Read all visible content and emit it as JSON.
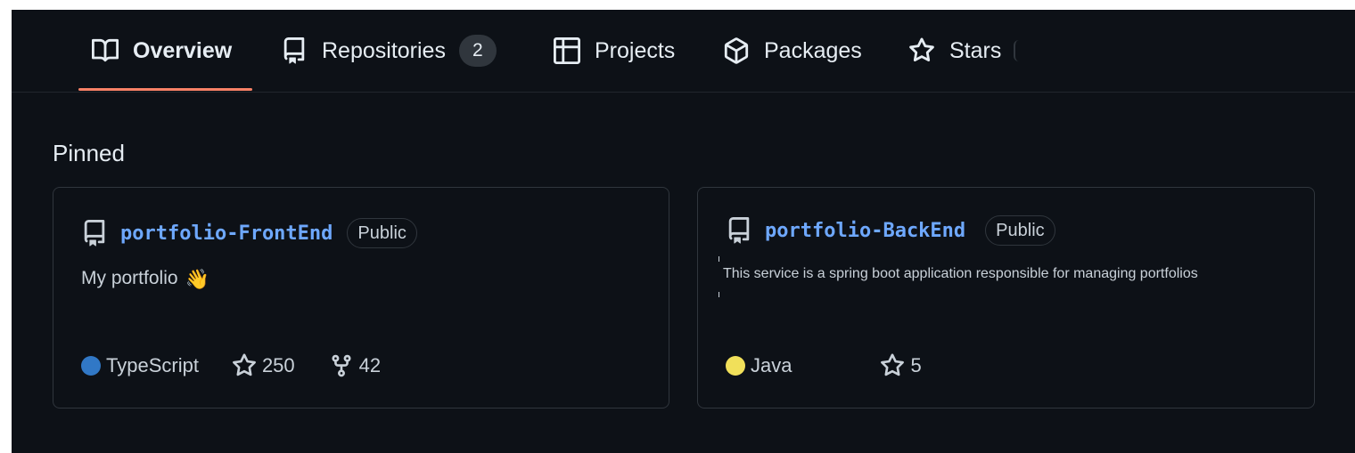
{
  "tabs": [
    {
      "label": "Overview",
      "icon": "book-icon",
      "active": true
    },
    {
      "label": "Repositories",
      "icon": "repo-icon",
      "count": "2"
    },
    {
      "label": "Projects",
      "icon": "table-icon"
    },
    {
      "label": "Packages",
      "icon": "package-icon"
    },
    {
      "label": "Stars",
      "icon": "star-icon"
    }
  ],
  "pinned": {
    "title": "Pinned",
    "cards": [
      {
        "name": "portfolio-FrontEnd",
        "visibility": "Public",
        "description": "My portfolio",
        "emoji": "👋",
        "language": "TypeScript",
        "language_color": "#3178c6",
        "stars": "250",
        "forks": "42"
      },
      {
        "name": "portfolio-BackEnd",
        "visibility": "Public",
        "description": "This service is a spring boot application responsible for managing portfolios",
        "language": "Java",
        "language_color": "#f1e05a",
        "stars": "5"
      }
    ]
  },
  "colors": {
    "background": "#0d1117",
    "accent_underline": "#f78166",
    "link": "#6ea8fe",
    "border": "#30363d"
  }
}
